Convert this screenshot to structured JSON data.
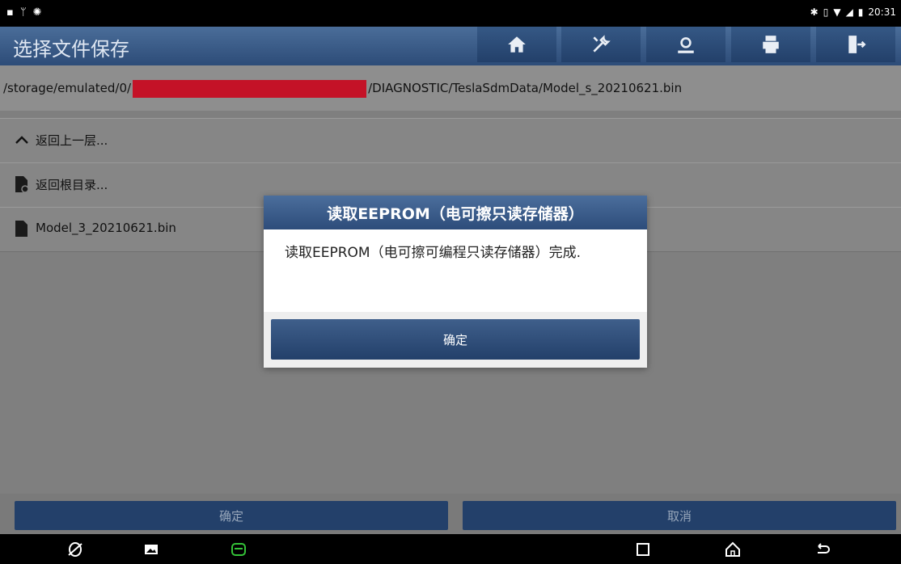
{
  "status_bar": {
    "time": "20:31"
  },
  "header": {
    "title": "选择文件保存",
    "buttons": [
      "home-icon",
      "tools-icon",
      "support-icon",
      "print-icon",
      "exit-icon"
    ]
  },
  "path": {
    "prefix": "/storage/emulated/0/",
    "suffix": "/DIAGNOSTIC/TeslaSdmData/Model_s_20210621.bin"
  },
  "file_list": {
    "items": [
      {
        "label": "返回上一层...",
        "icon": "chevron-up-icon"
      },
      {
        "label": "返回根目录...",
        "icon": "root-folder-icon"
      },
      {
        "label": "Model_3_20210621.bin",
        "icon": "file-icon"
      }
    ]
  },
  "footer": {
    "confirm_label": "确定",
    "cancel_label": "取消"
  },
  "dialog": {
    "title": "读取EEPROM（电可擦只读存储器）",
    "message": "读取EEPROM（电可擦可编程只读存储器）完成.",
    "ok_label": "确定"
  },
  "colors": {
    "header_blue": "#2d4c78",
    "redaction": "#c41227",
    "button_blue": "#23406a"
  }
}
